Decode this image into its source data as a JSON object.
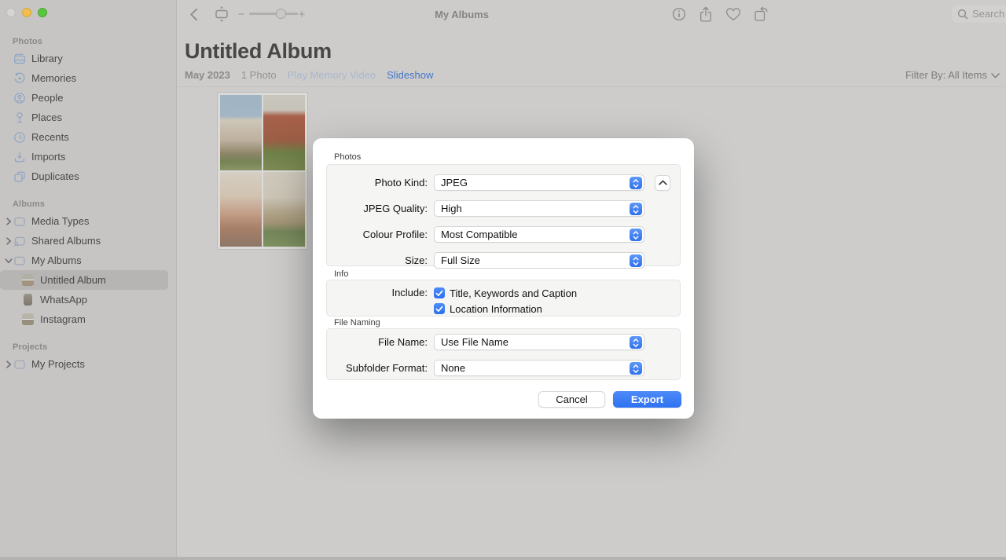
{
  "toolbar": {
    "title": "My Albums",
    "search_placeholder": "Search",
    "zoom_minus": "−",
    "zoom_plus": "+"
  },
  "sidebar": {
    "sections": [
      {
        "title": "Photos",
        "items": [
          {
            "label": "Library",
            "icon": "library-icon"
          },
          {
            "label": "Memories",
            "icon": "memories-icon"
          },
          {
            "label": "People",
            "icon": "people-icon"
          },
          {
            "label": "Places",
            "icon": "places-icon"
          },
          {
            "label": "Recents",
            "icon": "recents-icon"
          },
          {
            "label": "Imports",
            "icon": "imports-icon"
          },
          {
            "label": "Duplicates",
            "icon": "duplicates-icon"
          }
        ]
      },
      {
        "title": "Albums",
        "items": [
          {
            "label": "Media Types",
            "icon": "folder-icon",
            "chevron": "right"
          },
          {
            "label": "Shared Albums",
            "icon": "shared-folder-icon",
            "chevron": "right"
          },
          {
            "label": "My Albums",
            "icon": "folder-icon",
            "chevron": "down"
          },
          {
            "label": "Untitled Album",
            "icon": "album-thumbnail",
            "selected": true
          },
          {
            "label": "WhatsApp",
            "icon": "album-thumbnail"
          },
          {
            "label": "Instagram",
            "icon": "album-thumbnail"
          }
        ]
      },
      {
        "title": "Projects",
        "items": [
          {
            "label": "My Projects",
            "icon": "folder-icon",
            "chevron": "right"
          }
        ]
      }
    ]
  },
  "content": {
    "album_title": "Untitled Album",
    "date": "May 2023",
    "photo_count": "1 Photo",
    "play_memory_video": "Play Memory Video",
    "slideshow": "Slideshow",
    "filter_label": "Filter By: All Items"
  },
  "dialog": {
    "photos_section": {
      "label": "Photos",
      "rows": [
        {
          "label": "Photo Kind:",
          "value": "JPEG"
        },
        {
          "label": "JPEG Quality:",
          "value": "High"
        },
        {
          "label": "Colour Profile:",
          "value": "Most Compatible"
        },
        {
          "label": "Size:",
          "value": "Full Size"
        }
      ]
    },
    "info_section": {
      "label": "Info",
      "include_label": "Include:",
      "checkboxes": [
        {
          "label": "Title, Keywords and Caption",
          "checked": true
        },
        {
          "label": "Location Information",
          "checked": true
        }
      ]
    },
    "file_naming_section": {
      "label": "File Naming",
      "rows": [
        {
          "label": "File Name:",
          "value": "Use File Name"
        },
        {
          "label": "Subfolder Format:",
          "value": "None"
        }
      ]
    },
    "buttons": {
      "cancel": "Cancel",
      "export": "Export"
    },
    "colors": {
      "accent": "#3b7ef7",
      "export_button": "#3d7df5"
    }
  }
}
